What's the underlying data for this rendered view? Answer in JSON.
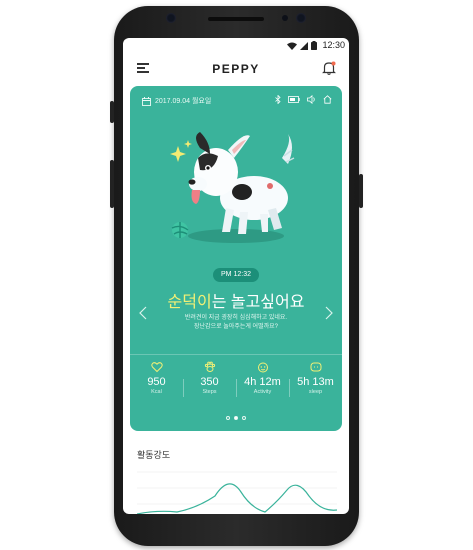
{
  "status": {
    "time": "12:30"
  },
  "app": {
    "title": "PEPPY"
  },
  "card": {
    "date": "2017.09.04 월요일",
    "time_pill": "PM 12:32",
    "headline_name": "순덕이",
    "headline_rest": "는 놀고싶어요",
    "subtitle_line1": "반려견이 지금 굉장히 심심해하고 있네요.",
    "subtitle_line2": "장난감으로 놀아주는게 어떨까요?",
    "stats": [
      {
        "icon": "heart-icon",
        "value": "950",
        "label": "Kcal"
      },
      {
        "icon": "paw-icon",
        "value": "350",
        "label": "Steps"
      },
      {
        "icon": "face-icon",
        "value": "4h 12m",
        "label": "Activity"
      },
      {
        "icon": "sleep-icon",
        "value": "5h 13m",
        "label": "sleep"
      }
    ],
    "page_index": 2,
    "page_count": 3
  },
  "section": {
    "title": "활동강도"
  },
  "colors": {
    "card_bg": "#3ab39b",
    "pill_bg": "#1c8f79",
    "highlight": "#f3f075",
    "graph_line": "#3ab39b"
  }
}
